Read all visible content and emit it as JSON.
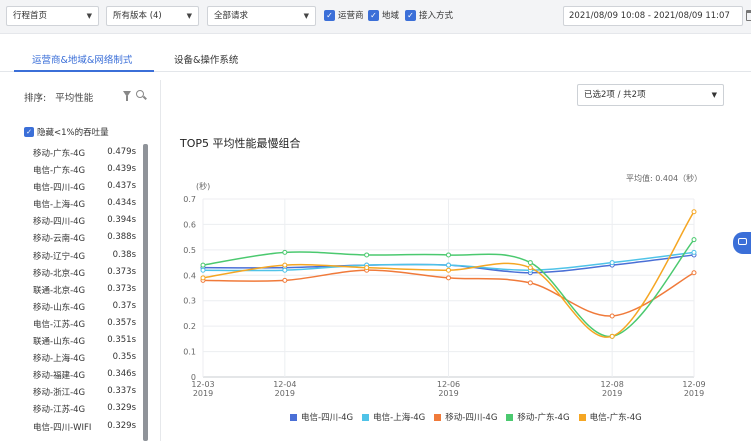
{
  "toolbar": {
    "page_select": "行程首页",
    "version_select": "所有版本 (4)",
    "request_select": "全部请求",
    "checkboxes": [
      "运营商",
      "地域",
      "接入方式"
    ],
    "date_range": "2021/08/09 10:08 - 2021/08/09 11:07"
  },
  "tabs": [
    {
      "label": "运营商&地域&网络制式",
      "active": true
    },
    {
      "label": "设备&操作系统",
      "active": false
    }
  ],
  "sidebar": {
    "sort_label": "排序:",
    "sort_value": "平均性能",
    "hide_label": "隐藏<1%的吞吐量",
    "items": [
      {
        "name": "移动-广东-4G",
        "value": "0.479s"
      },
      {
        "name": "电信-广东-4G",
        "value": "0.439s"
      },
      {
        "name": "电信-四川-4G",
        "value": "0.437s"
      },
      {
        "name": "电信-上海-4G",
        "value": "0.434s"
      },
      {
        "name": "移动-四川-4G",
        "value": "0.394s"
      },
      {
        "name": "移动-云南-4G",
        "value": "0.388s"
      },
      {
        "name": "移动-辽宁-4G",
        "value": "0.38s"
      },
      {
        "name": "移动-北京-4G",
        "value": "0.373s"
      },
      {
        "name": "联通-北京-4G",
        "value": "0.373s"
      },
      {
        "name": "移动-山东-4G",
        "value": "0.37s"
      },
      {
        "name": "电信-江苏-4G",
        "value": "0.357s"
      },
      {
        "name": "联通-山东-4G",
        "value": "0.351s"
      },
      {
        "name": "移动-上海-4G",
        "value": "0.35s"
      },
      {
        "name": "移动-福建-4G",
        "value": "0.346s"
      },
      {
        "name": "移动-浙江-4G",
        "value": "0.337s"
      },
      {
        "name": "移动-江苏-4G",
        "value": "0.329s"
      },
      {
        "name": "电信-四川-WIFI",
        "value": "0.329s"
      }
    ]
  },
  "selector": {
    "label": "已选2项 / 共2项"
  },
  "chart_title": "TOP5 平均性能最慢组合",
  "avg_label": "平均值: 0.404（秒）",
  "colors": {
    "accent": "#3b6fd8"
  },
  "icons": [
    "filter-icon",
    "search-icon",
    "calendar-icon",
    "chevron-down-icon",
    "feedback-icon"
  ],
  "chart_data": {
    "type": "line",
    "ylabel": "(秒)",
    "ylim": [
      0,
      0.7
    ],
    "yticks": [
      "0",
      "0.1",
      "0.2",
      "0.3",
      "0.4",
      "0.5",
      "0.6",
      "0.7"
    ],
    "x": [
      0,
      1,
      2,
      3,
      4,
      5,
      6
    ],
    "xticks": [
      {
        "at": 0,
        "line1": "12-03",
        "line2": "2019"
      },
      {
        "at": 1,
        "line1": "12-04",
        "line2": "2019"
      },
      {
        "at": 3,
        "line1": "12-06",
        "line2": "2019"
      },
      {
        "at": 5,
        "line1": "12-08",
        "line2": "2019"
      },
      {
        "at": 6,
        "line1": "12-09",
        "line2": "2019"
      }
    ],
    "legend_position": "bottom",
    "grid": true,
    "series": [
      {
        "name": "电信-四川-4G",
        "color": "#4a6fd6",
        "values": [
          0.43,
          0.43,
          0.44,
          0.44,
          0.41,
          0.44,
          0.48
        ]
      },
      {
        "name": "电信-上海-4G",
        "color": "#4fc3e8",
        "values": [
          0.42,
          0.42,
          0.44,
          0.44,
          0.42,
          0.45,
          0.49
        ]
      },
      {
        "name": "移动-四川-4G",
        "color": "#f07a3a",
        "values": [
          0.38,
          0.38,
          0.42,
          0.39,
          0.37,
          0.24,
          0.41
        ]
      },
      {
        "name": "移动-广东-4G",
        "color": "#4bc96f",
        "values": [
          0.44,
          0.49,
          0.48,
          0.48,
          0.45,
          0.16,
          0.54
        ]
      },
      {
        "name": "电信-广东-4G",
        "color": "#f5a623",
        "values": [
          0.39,
          0.44,
          0.43,
          0.42,
          0.43,
          0.16,
          0.65
        ]
      }
    ]
  }
}
